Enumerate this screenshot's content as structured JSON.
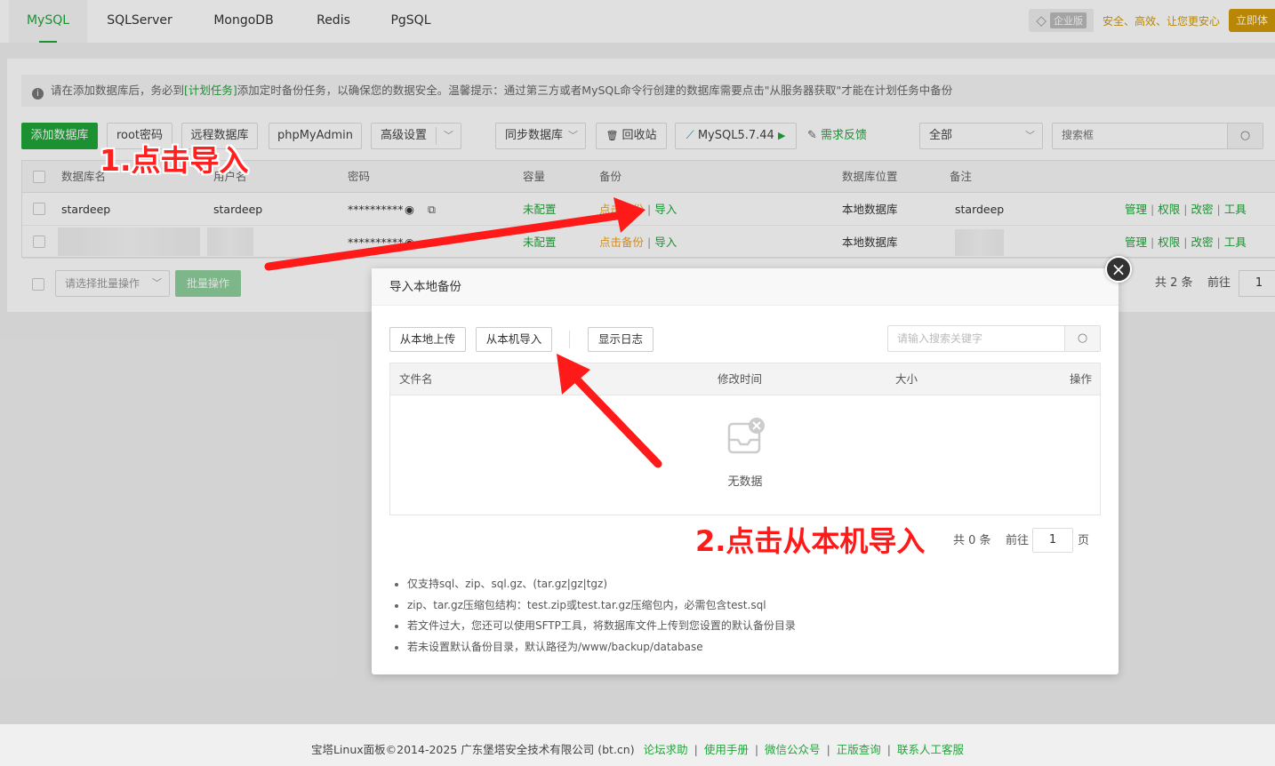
{
  "tabs": [
    "MySQL",
    "SQLServer",
    "MongoDB",
    "Redis",
    "PgSQL"
  ],
  "enterprise": {
    "badge": "企业版",
    "slogan": "安全、高效、让您更安心",
    "button": "立即体"
  },
  "notice": {
    "prefix": "请在添加数据库后，务必到",
    "link": "[计划任务]",
    "suffix": "添加定时备份任务，以确保您的数据安全。温馨提示：通过第三方或者MySQL命令行创建的数据库需要点击\"从服务器获取\"才能在计划任务中备份"
  },
  "toolbar": {
    "add_db": "添加数据库",
    "root_pwd": "root密码",
    "remote_db": "远程数据库",
    "phpmyadmin": "phpMyAdmin",
    "advanced": "高级设置",
    "sync_db": "同步数据库",
    "recycle": "回收站",
    "mysql_version": "MySQL5.7.44",
    "feedback": "需求反馈",
    "filter": "全部",
    "search_placeholder": "搜索框"
  },
  "table": {
    "headers": [
      "数据库名",
      "用户名",
      "密码",
      "容量",
      "备份",
      "数据库位置",
      "备注"
    ],
    "rows": [
      {
        "name": "stardeep",
        "user": "stardeep",
        "password": "**********",
        "capacity": "未配置",
        "backup": "点击备份",
        "import": "导入",
        "location": "本地数据库",
        "remark": "stardeep"
      },
      {
        "name": "",
        "user": "",
        "password": "**********",
        "capacity": "未配置",
        "backup": "点击备份",
        "import": "导入",
        "location": "本地数据库",
        "remark": ""
      }
    ],
    "actions": [
      "管理",
      "权限",
      "改密",
      "工具"
    ]
  },
  "bottom": {
    "batch_select": "请选择批量操作",
    "batch_btn": "批量操作",
    "total": "共 2 条",
    "goto": "前往",
    "page": "1"
  },
  "modal": {
    "title": "导入本地备份",
    "upload_local": "从本地上传",
    "import_machine": "从本机导入",
    "show_log": "显示日志",
    "search_placeholder": "请输入搜索关键字",
    "headers": [
      "文件名",
      "修改时间",
      "大小",
      "操作"
    ],
    "empty": "无数据",
    "total": "共 0 条",
    "goto": "前往",
    "page": "1",
    "page_unit": "页",
    "tips": [
      "仅支持sql、zip、sql.gz、(tar.gz|gz|tgz)",
      "zip、tar.gz压缩包结构：test.zip或test.tar.gz压缩包内，必需包含test.sql",
      "若文件过大，您还可以使用SFTP工具，将数据库文件上传到您设置的默认备份目录",
      "若未设置默认备份目录，默认路径为/www/backup/database"
    ]
  },
  "annotations": {
    "step1": "1.点击导入",
    "step2": "2.点击从本机导入"
  },
  "footer": {
    "copyright": "宝塔Linux面板©2014-2025 广东堡塔安全技术有限公司 (bt.cn)",
    "links": [
      "论坛求助",
      "使用手册",
      "微信公众号",
      "正版查询",
      "联系人工客服"
    ]
  },
  "colors": {
    "accent": "#20a53a",
    "warning": "#f0a020",
    "annotation": "#ff1a1a"
  }
}
